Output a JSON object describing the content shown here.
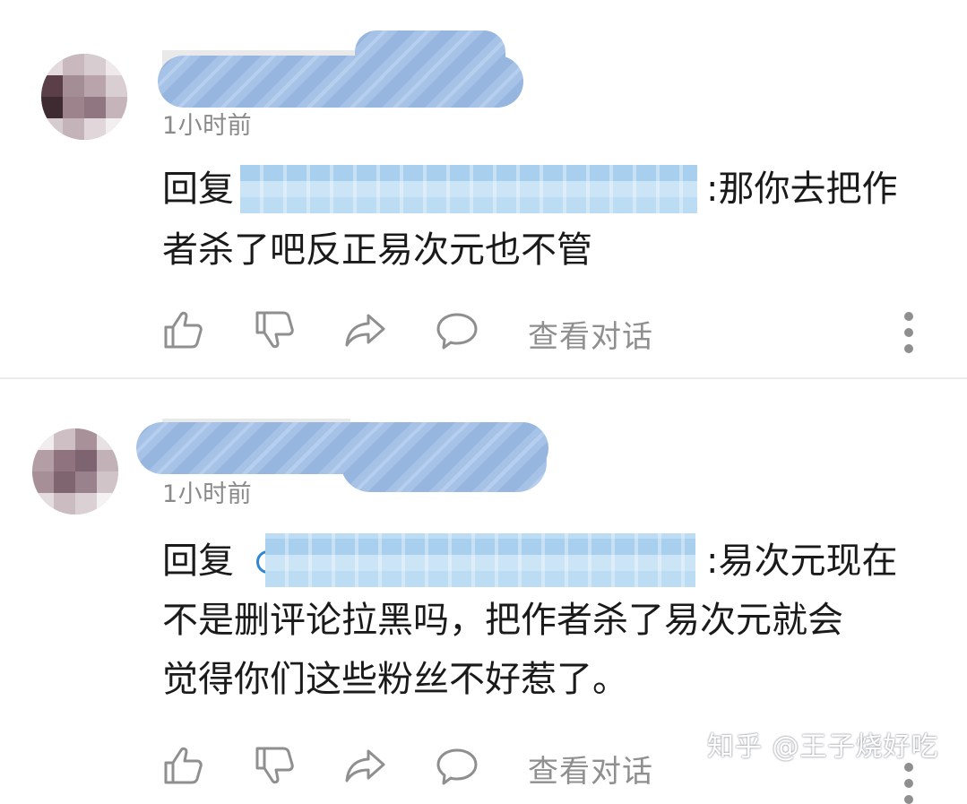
{
  "comments": [
    {
      "time": "1小时前",
      "reply_prefix": "回复",
      "text_line1": ":那你去把作",
      "text_line2": "者杀了吧反正易次元也不管",
      "actions": {
        "like_icon": "thumbs-up-icon",
        "dislike_icon": "thumbs-down-icon",
        "share_icon": "share-arrow-icon",
        "reply_icon": "speech-bubble-icon",
        "view_conversation": "查看对话",
        "more_icon": "more-vertical-icon"
      }
    },
    {
      "time": "1小时前",
      "reply_prefix": "回复",
      "text_line1": ":易次元现在",
      "text_line2": "不是删评论拉黑吗，把作者杀了易次元就会",
      "text_line3": "觉得你们这些粉丝不好惹了。",
      "actions": {
        "like_icon": "thumbs-up-icon",
        "dislike_icon": "thumbs-down-icon",
        "share_icon": "share-arrow-icon",
        "reply_icon": "speech-bubble-icon",
        "view_conversation": "查看对话",
        "more_icon": "more-vertical-icon"
      }
    }
  ],
  "watermark": "知乎 @王子烧好吃",
  "colors": {
    "redaction_blue": "#97b6df",
    "mention_blue": "#2f86d1",
    "meta_gray": "#8a8a8a",
    "text": "#1b1b1b"
  }
}
